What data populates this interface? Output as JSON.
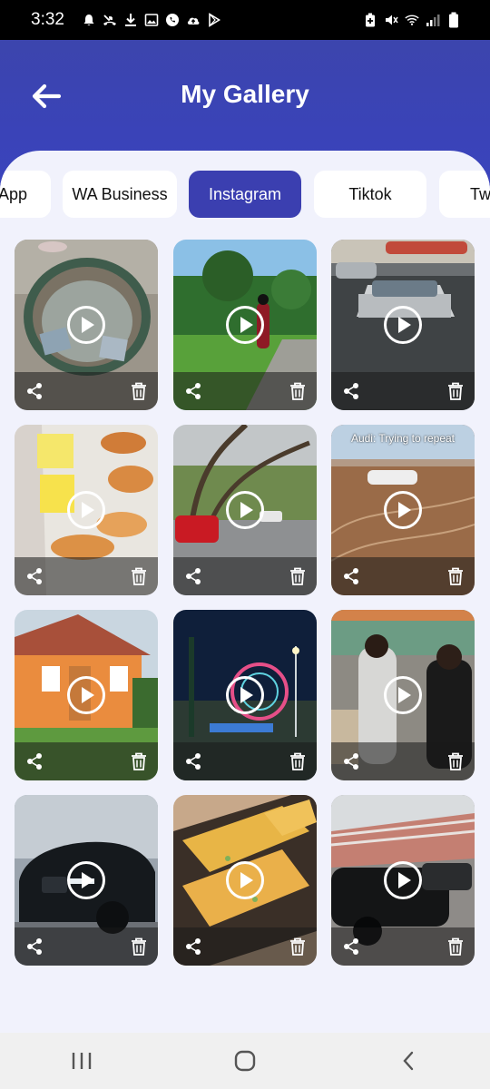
{
  "status_bar": {
    "time": "3:32"
  },
  "header": {
    "title": "My Gallery"
  },
  "tabs": [
    {
      "label": "WhatsApp",
      "active": false
    },
    {
      "label": "WA Business",
      "active": false
    },
    {
      "label": "Instagram",
      "active": true
    },
    {
      "label": "Tiktok",
      "active": false
    },
    {
      "label": "Twitter",
      "active": false
    }
  ],
  "grid": {
    "items": [
      {
        "name": "video-1"
      },
      {
        "name": "video-2"
      },
      {
        "name": "video-3"
      },
      {
        "name": "video-4"
      },
      {
        "name": "video-5"
      },
      {
        "name": "video-6",
        "overlay": "Audi: Trying to repeat"
      },
      {
        "name": "video-7"
      },
      {
        "name": "video-8"
      },
      {
        "name": "video-9"
      },
      {
        "name": "video-10"
      },
      {
        "name": "video-11"
      },
      {
        "name": "video-12"
      }
    ]
  },
  "icons": {
    "back": "arrow-left-icon",
    "play": "play-icon",
    "share": "share-icon",
    "delete": "trash-icon"
  },
  "colors": {
    "header": "#3b44bd",
    "active_tab": "#3b3fb0",
    "background": "#f1f2fc"
  }
}
